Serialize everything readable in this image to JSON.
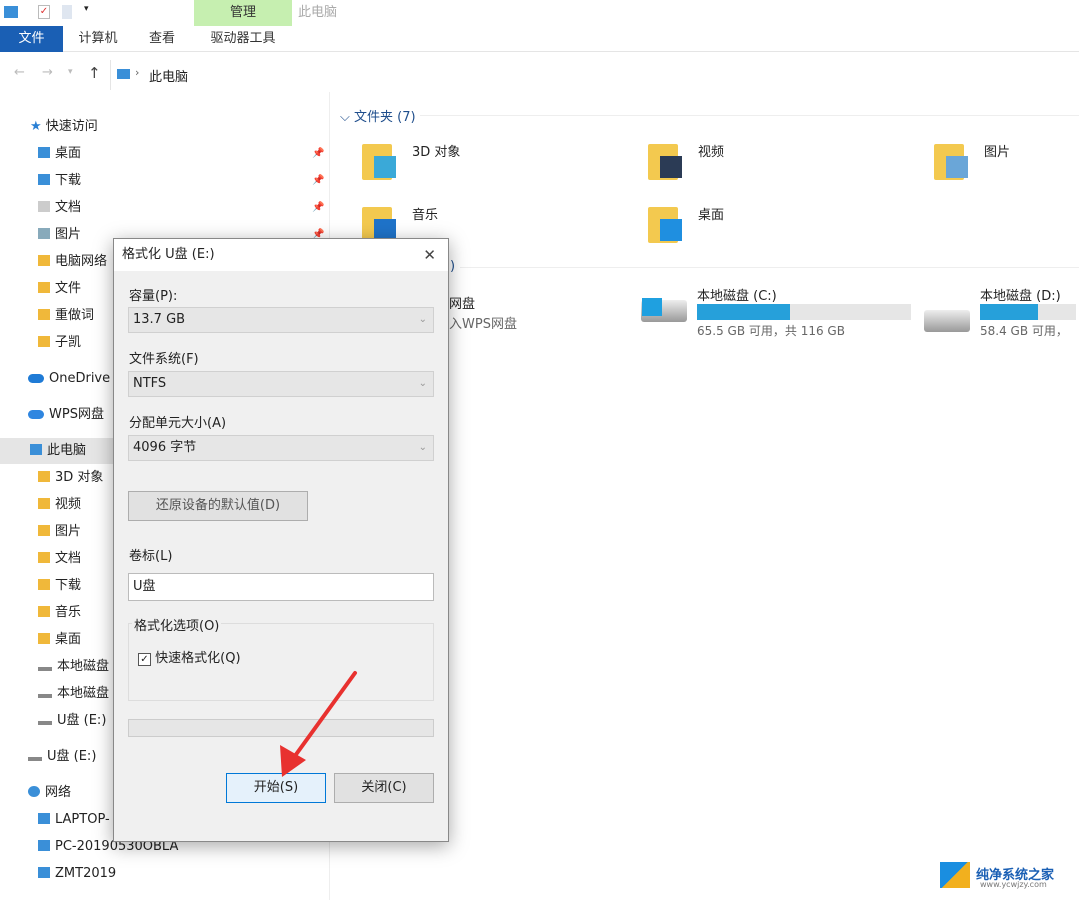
{
  "ribbon": {
    "context_tab": "管理",
    "context_title": "此电脑",
    "tabs": [
      "文件",
      "计算机",
      "查看",
      "驱动器工具"
    ]
  },
  "address": {
    "path": "此电脑"
  },
  "sidebar": {
    "quick_access": "快速访问",
    "quick_items": [
      "桌面",
      "下载",
      "文档",
      "图片",
      "电脑网络",
      "文件",
      "重做词",
      "子凯"
    ],
    "onedrive": "OneDrive",
    "wps": "WPS网盘",
    "this_pc": "此电脑",
    "pc_items": [
      "3D 对象",
      "视频",
      "图片",
      "文档",
      "下载",
      "音乐",
      "桌面",
      "本地磁盘",
      "本地磁盘",
      "U盘 (E:)"
    ],
    "usb": "U盘 (E:)",
    "network": "网络",
    "net_items": [
      "LAPTOP-",
      "PC-20190530OBLA",
      "ZMT2019"
    ]
  },
  "main": {
    "folders_header": "文件夹 (7)",
    "folders": [
      "3D 对象",
      "视频",
      "图片",
      "音乐",
      "桌面"
    ],
    "devices_header_partial": ")",
    "wps": {
      "name": "网盘",
      "sub": "入WPS网盘"
    },
    "drives": [
      {
        "name": "本地磁盘 (C:)",
        "info": "65.5 GB 可用，共 116 GB",
        "used_pct": 43.5
      },
      {
        "name": "本地磁盘 (D:)",
        "info": "58.4 GB 可用，",
        "used_pct": 60
      }
    ]
  },
  "dialog": {
    "title": "格式化 U盘 (E:)",
    "capacity_label": "容量(P):",
    "capacity": "13.7 GB",
    "fs_label": "文件系统(F)",
    "fs": "NTFS",
    "alloc_label": "分配单元大小(A)",
    "alloc": "4096 字节",
    "restore": "还原设备的默认值(D)",
    "volume_label": "卷标(L)",
    "volume": "U盘",
    "options_label": "格式化选项(O)",
    "quick": "快速格式化(Q)",
    "quick_checked": true,
    "progress": 0,
    "start": "开始(S)",
    "close": "关闭(C)"
  },
  "watermark": {
    "text": "纯净系统之家",
    "url": "www.ycwjzy.com"
  }
}
